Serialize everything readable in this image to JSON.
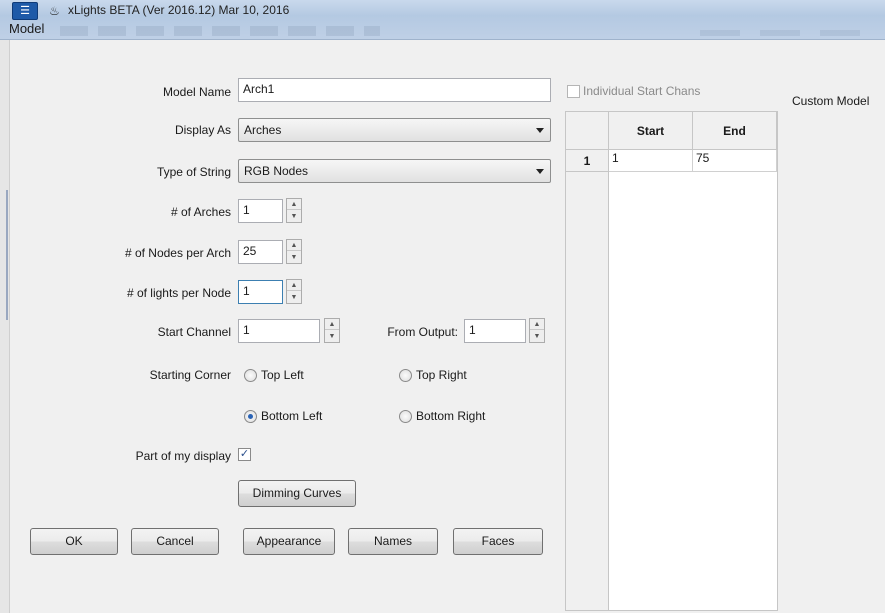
{
  "window": {
    "title": "xLights BETA (Ver 2016.12) Mar 10, 2016",
    "section": "Model"
  },
  "form": {
    "model_name_label": "Model Name",
    "model_name_value": "Arch1",
    "display_as_label": "Display As",
    "display_as_value": "Arches",
    "string_type_label": "Type of String",
    "string_type_value": "RGB Nodes",
    "num_arches_label": "# of Arches",
    "num_arches_value": "1",
    "nodes_per_arch_label": "# of Nodes per Arch",
    "nodes_per_arch_value": "25",
    "lights_per_node_label": "# of lights per Node",
    "lights_per_node_value": "1",
    "start_channel_label": "Start Channel",
    "start_channel_value": "1",
    "from_output_label": "From Output:",
    "from_output_value": "1",
    "starting_corner_label": "Starting Corner",
    "corners": {
      "top_left": "Top Left",
      "top_right": "Top Right",
      "bottom_left": "Bottom Left",
      "bottom_right": "Bottom Right",
      "selected": "Bottom Left"
    },
    "part_of_display_label": "Part of my display",
    "part_of_display_checked": true,
    "dimming_curves_button": "Dimming Curves"
  },
  "channels": {
    "individual_start_label": "Individual Start Chans",
    "individual_start_checked": false,
    "columns": [
      "",
      "Start",
      "End"
    ],
    "rows": [
      {
        "index": "1",
        "start": "1",
        "end": "75"
      }
    ]
  },
  "custom_model_label": "Custom Model",
  "buttons": {
    "ok": "OK",
    "cancel": "Cancel",
    "appearance": "Appearance",
    "names": "Names",
    "faces": "Faces"
  }
}
